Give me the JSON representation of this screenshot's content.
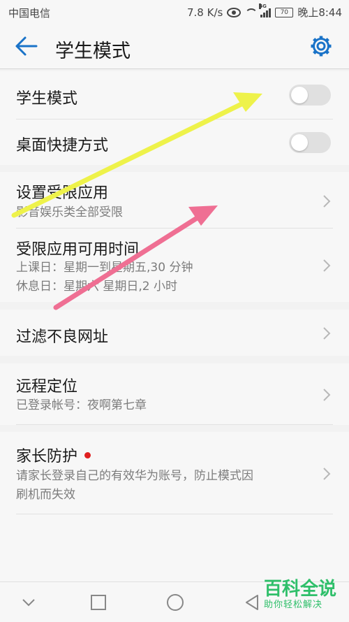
{
  "status": {
    "carrier": "中国电信",
    "speed": "7.8 K/s",
    "network": "4G",
    "battery": "70",
    "time": "晚上8:44"
  },
  "header": {
    "title": "学生模式"
  },
  "settings": {
    "student_mode": {
      "label": "学生模式",
      "enabled": false
    },
    "desktop_shortcut": {
      "label": "桌面快捷方式",
      "enabled": false
    },
    "restricted_apps": {
      "label": "设置受限应用",
      "sub": "影音娱乐类全部受限"
    },
    "restricted_time": {
      "label": "受限应用可用时间",
      "sub1": "上课日：星期一到星期五,30 分钟",
      "sub2": "休息日：星期六 星期日,2 小时"
    },
    "filter_sites": {
      "label": "过滤不良网址"
    },
    "remote_location": {
      "label": "远程定位",
      "sub": "已登录帐号：夜啊第七章"
    },
    "parental_protection": {
      "label": "家长防护",
      "sub1": "请家长登录自己的有效华为账号，防止模式因",
      "sub2": "刷机而失效"
    }
  },
  "watermark": {
    "main": "百科全说",
    "sub": "助你轻松解决"
  },
  "colors": {
    "accent": "#1a73c8",
    "arrow_yellow": "#eef24a",
    "arrow_pink": "#ef6f93",
    "badge_red": "#e02020",
    "watermark_green": "#2fbf6a"
  }
}
